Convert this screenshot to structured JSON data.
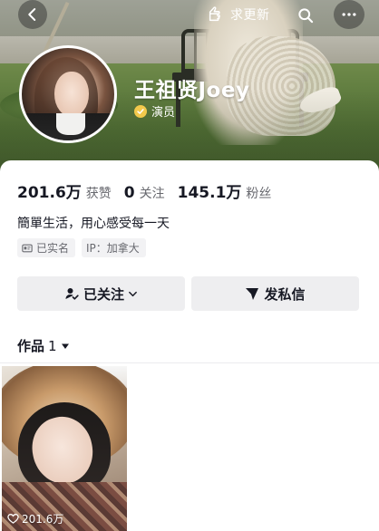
{
  "topbar": {
    "seek_update_label": "求更新"
  },
  "profile": {
    "name": "王祖贤Joey",
    "verified_title": "演员",
    "stats": [
      {
        "value": "201.6万",
        "label": "获赞"
      },
      {
        "value": "0",
        "label": "关注"
      },
      {
        "value": "145.1万",
        "label": "粉丝"
      }
    ],
    "bio": "簡單生活，用心感受每一天",
    "tags": [
      {
        "icon": "id-card-icon",
        "label": "已实名"
      },
      {
        "icon": "",
        "label": "IP：加拿大"
      }
    ]
  },
  "actions": {
    "followed_label": "已关注",
    "message_label": "发私信"
  },
  "works": {
    "tab_label": "作品",
    "count": "1",
    "items": [
      {
        "likes": "201.6万"
      }
    ]
  },
  "colors": {
    "text_primary": "#161823",
    "text_secondary": "#68696f",
    "button_bg": "#eeeef0",
    "verify_badge": "#f2c94c"
  }
}
